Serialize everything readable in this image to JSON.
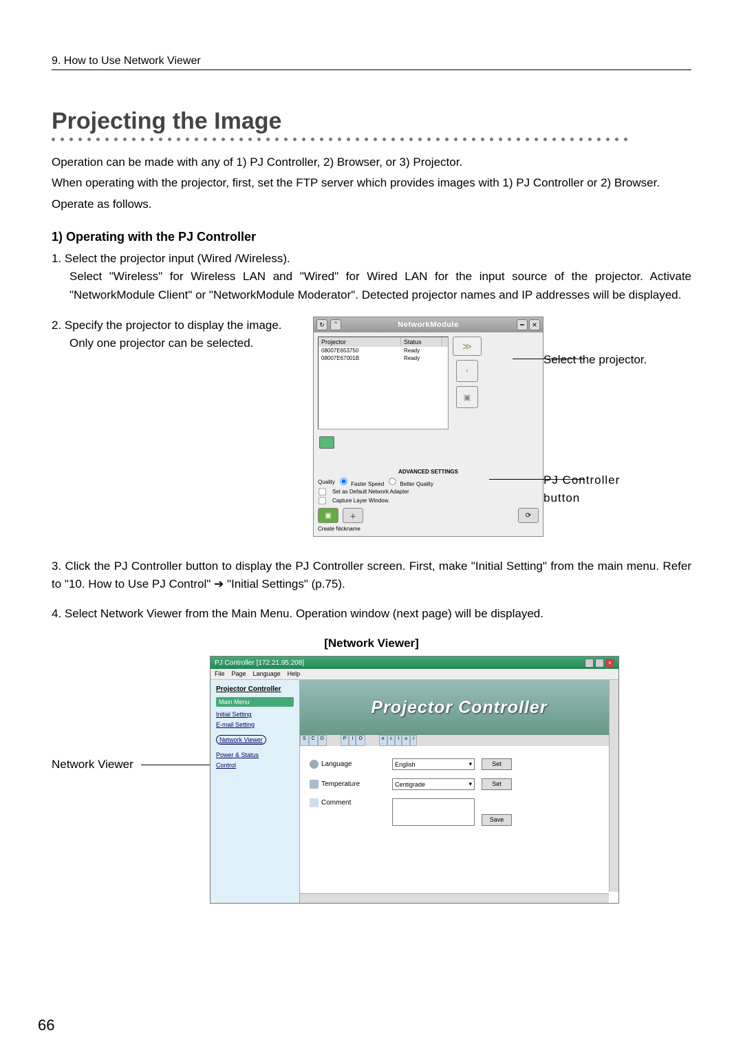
{
  "chapter": "9. How to Use Network Viewer",
  "title": "Projecting the Image",
  "intro": {
    "p1": "Operation can be made with any of 1) PJ Controller, 2) Browser, or 3) Projector.",
    "p2": "When operating with the projector, first, set the FTP server which provides images with 1) PJ Controller or 2) Browser.",
    "p3": "Operate as follows."
  },
  "sub1": "1) Operating with the PJ Controller",
  "steps": {
    "s1_lead": "1. Select the projector input (Wired /Wireless).",
    "s1_body": "Select \"Wireless\" for Wireless LAN and \"Wired\" for Wired LAN for the input source of the projector. Activate \"NetworkModule Client\" or \"NetworkModule Moderator\". Detected projector names and IP addresses will be displayed.",
    "s2_lead": "2. Specify the projector to display the image.",
    "s2_body": "Only one projector can be selected.",
    "s3": "3. Click the PJ Controller button to display the PJ Controller screen.  First, make \"Initial Setting\" from the main menu. Refer to \"10. How to Use PJ Control\" ➔ \"Initial Settings\" (p.75).",
    "s4": "4. Select Network Viewer from the Main Menu. Operation window (next page) will be displayed."
  },
  "callouts": {
    "c1": "Select the projector.",
    "c2a": "PJ Controller",
    "c2b": "button"
  },
  "nv_heading": "[Network Viewer]",
  "nv_label": "Network Viewer",
  "nm": {
    "title": "NetworkModule",
    "col_projector": "Projector",
    "col_status": "Status",
    "row1_proj": "08007E653750",
    "row1_stat": "Ready",
    "row2_proj": "08007E67001B",
    "row2_stat": "Ready",
    "adv": "ADVANCED SETTINGS",
    "quality": "Quality",
    "fast": "Faster Speed",
    "better": "Better Quality",
    "defnet": "Set as Default Network Adapter",
    "capture": "Capture Layer Window.",
    "nickname": "Create Nickname"
  },
  "pj": {
    "title": "PJ Controller [172.21.95.208]",
    "menu_file": "File",
    "menu_page": "Page",
    "menu_lang": "Language",
    "menu_help": "Help",
    "side_title": "Projector Controller",
    "side_main": "Main Menu",
    "side_initial": "Initial Setting",
    "side_email": "E-mail Setting",
    "side_nv": "Network Viewer",
    "side_power": "Power & Status",
    "side_control": "Control",
    "banner": "Projector Controller",
    "row_lang": "Language",
    "row_lang_val": "English",
    "row_temp": "Temperature",
    "row_temp_val": "Centigrade",
    "row_comment": "Comment",
    "btn_set": "Set",
    "btn_save": "Save"
  },
  "page_num": "66"
}
